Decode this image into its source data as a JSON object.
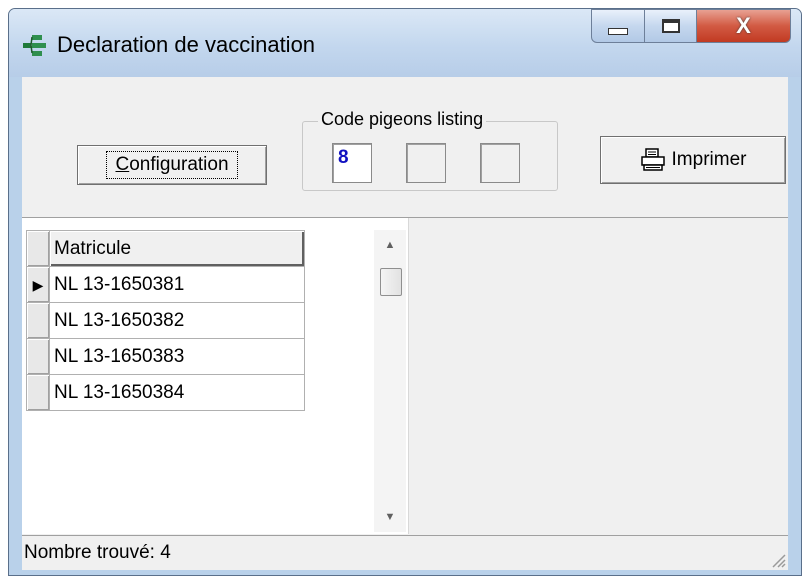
{
  "window": {
    "title": "Declaration de vaccination",
    "caption_buttons": [
      "minimize-icon",
      "maximize-icon",
      "close-icon"
    ],
    "close_glyph": "X"
  },
  "toolbar": {
    "config_label_hotkey": "C",
    "config_label_rest": "onfiguration",
    "print_label": "Imprimer",
    "print_icon": "printer-icon"
  },
  "code_listing": {
    "legend": "Code pigeons listing",
    "values": [
      "8",
      "",
      ""
    ]
  },
  "grid": {
    "column_header": "Matricule",
    "rows": [
      {
        "matricule": "NL 13-1650381",
        "selected": true
      },
      {
        "matricule": "NL 13-1650382",
        "selected": false
      },
      {
        "matricule": "NL 13-1650383",
        "selected": false
      },
      {
        "matricule": "NL 13-1650384",
        "selected": false
      }
    ],
    "current_row_indicator": "▶"
  },
  "status": {
    "text": "Nombre trouvé: 4"
  },
  "colors": {
    "code_text": "#1010c0",
    "close_button": "#c84a31",
    "titlebar": "#c3d7ee"
  }
}
